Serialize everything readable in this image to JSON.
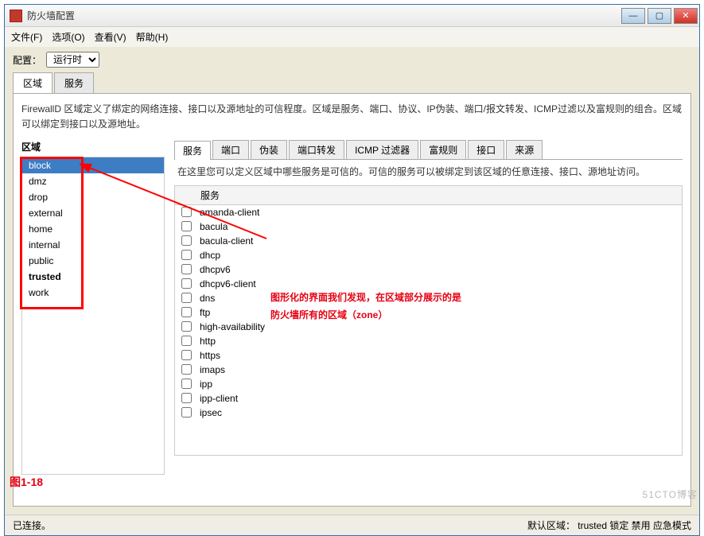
{
  "window": {
    "title": "防火墙配置",
    "min": "—",
    "max": "▢",
    "close": "✕"
  },
  "menu": {
    "file": "文件(F)",
    "options": "选项(O)",
    "view": "查看(V)",
    "help": "帮助(H)"
  },
  "toolbar": {
    "config_label": "配置：",
    "config_value": "运行时"
  },
  "main_tabs": {
    "zones": "区域",
    "services": "服务"
  },
  "descriptions": {
    "zones": "FirewallD 区域定义了绑定的网络连接、接口以及源地址的可信程度。区域是服务、端口、协议、IP伪装、端口/报文转发、ICMP过滤以及富规则的组合。区域可以绑定到接口以及源地址。"
  },
  "zone_panel": {
    "header": "区域",
    "items": [
      {
        "label": "block",
        "selected": true
      },
      {
        "label": "dmz"
      },
      {
        "label": "drop"
      },
      {
        "label": "external"
      },
      {
        "label": "home"
      },
      {
        "label": "internal"
      },
      {
        "label": "public"
      },
      {
        "label": "trusted",
        "bold": true
      },
      {
        "label": "work"
      }
    ]
  },
  "sub_tabs": {
    "services": "服务",
    "ports": "端口",
    "masq": "伪装",
    "portfwd": "端口转发",
    "icmp": "ICMP 过滤器",
    "rich": "富规则",
    "ifaces": "接口",
    "sources": "来源"
  },
  "services_panel": {
    "desc": "在这里您可以定义区域中哪些服务是可信的。可信的服务可以被绑定到该区域的任意连接、接口、源地址访问。",
    "col_header": "服务",
    "items": [
      "amanda-client",
      "bacula",
      "bacula-client",
      "dhcp",
      "dhcpv6",
      "dhcpv6-client",
      "dns",
      "ftp",
      "high-availability",
      "http",
      "https",
      "imaps",
      "ipp",
      "ipp-client",
      "ipsec"
    ]
  },
  "statusbar": {
    "left": "已连接。",
    "right": "默认区域： trusted 锁定 禁用 应急模式"
  },
  "annotations": {
    "line1": "图形化的界面我们发现，在区域部分展示的是",
    "line2": "防火墙所有的区域（zone）",
    "figure": "图1-18"
  },
  "watermark": "51CTO博客"
}
